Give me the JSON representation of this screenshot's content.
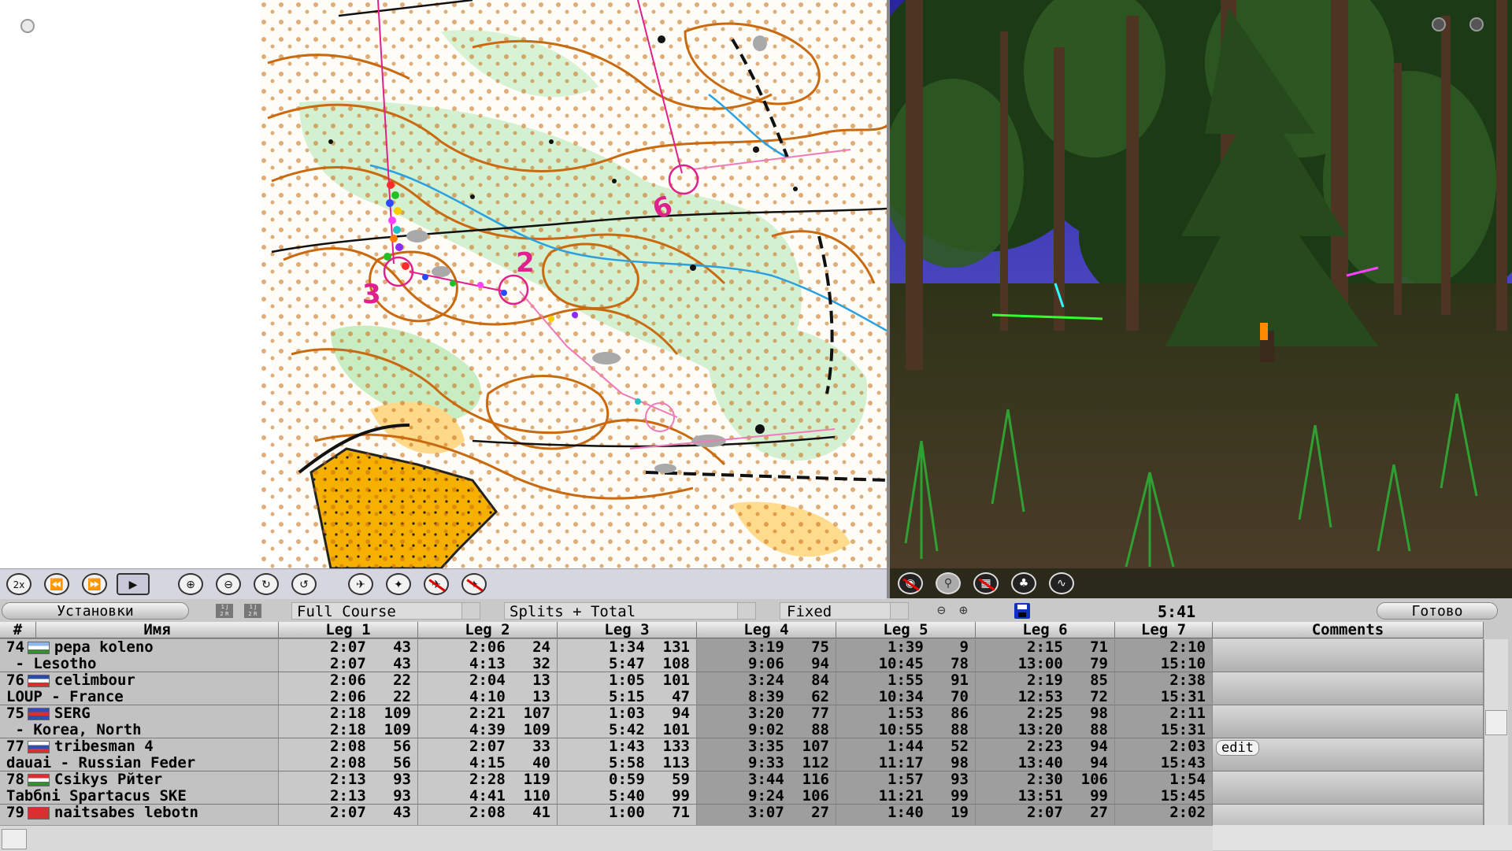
{
  "map_toolbar": {
    "speed_label": "2x",
    "icons": [
      "speed-icon",
      "rewind-icon",
      "fast-forward-icon",
      "play-icon",
      "zoom-in-icon",
      "zoom-out-icon",
      "rotate-right-icon",
      "rotate-left-icon",
      "runner-icon",
      "compass-icon",
      "route-off-icon",
      "tail-off-icon"
    ]
  },
  "view_toolbar": {
    "icons": [
      "camera-off-icon",
      "search-icon",
      "map-off-icon",
      "tree-icon",
      "route-icon"
    ]
  },
  "control_bar": {
    "settings_label": "Установки",
    "course_value": "Full Course",
    "splits_value": "Splits + Total",
    "mode_value": "Fixed",
    "time": "5:41",
    "done_label": "Готово",
    "mini_icon_1": "1 Job\n2 Rob\n3 Bot",
    "mini_icon_2": "1 Job\n2 Rob\n3 Bot"
  },
  "table": {
    "headers": [
      "#",
      "Имя",
      "Leg 1",
      "Leg 2",
      "Leg 3",
      "Leg 4",
      "Leg 5",
      "Leg 6",
      "Leg 7",
      "Comments"
    ],
    "rows": [
      {
        "line1": "74",
        "flag": [
          "#8fb8e8",
          "#ffffff",
          "#3a8a3a"
        ],
        "name1": "pepa koleno",
        "name2": " - Lesotho",
        "legs": [
          [
            "2:07   43",
            "2:07   43"
          ],
          [
            "2:06   24",
            "4:13   32"
          ],
          [
            "1:34  131",
            "5:47  108"
          ],
          [
            "3:19   75",
            "9:06   94"
          ],
          [
            "1:39    9",
            "10:45   78"
          ],
          [
            "2:15   71",
            "13:00   79"
          ],
          [
            "2:10",
            "15:10"
          ]
        ],
        "comment": ""
      },
      {
        "line1": "76",
        "flag": [
          "#2a4aa8",
          "#ffffff",
          "#d83030"
        ],
        "name1": "celimbour",
        "name2": "LOUP - France",
        "legs": [
          [
            "2:06   22",
            "2:06   22"
          ],
          [
            "2:04   13",
            "4:10   13"
          ],
          [
            "1:05  101",
            "5:15   47"
          ],
          [
            "3:24   84",
            "8:39   62"
          ],
          [
            "1:55   91",
            "10:34   70"
          ],
          [
            "2:19   85",
            "12:53   72"
          ],
          [
            "2:38",
            "15:31"
          ]
        ],
        "comment": ""
      },
      {
        "line1": "75",
        "flag": [
          "#3050b0",
          "#d83030",
          "#3050b0"
        ],
        "name1": "SERG",
        "name2": " - Korea, North",
        "legs": [
          [
            "2:18  109",
            "2:18  109"
          ],
          [
            "2:21  107",
            "4:39  109"
          ],
          [
            "1:03   94",
            "5:42  101"
          ],
          [
            "3:20   77",
            "9:02   88"
          ],
          [
            "1:53   86",
            "10:55   88"
          ],
          [
            "2:25   98",
            "13:20   88"
          ],
          [
            "2:11",
            "15:31"
          ]
        ],
        "comment": ""
      },
      {
        "line1": "77",
        "flag": [
          "#ffffff",
          "#3050b0",
          "#d83030"
        ],
        "name1": "tribesman 4",
        "name2": "dauai - Russian Feder",
        "legs": [
          [
            "2:08   56",
            "2:08   56"
          ],
          [
            "2:07   33",
            "4:15   40"
          ],
          [
            "1:43  133",
            "5:58  113"
          ],
          [
            "3:35  107",
            "9:33  112"
          ],
          [
            "1:44   52",
            "11:17   98"
          ],
          [
            "2:23   94",
            "13:40   94"
          ],
          [
            "2:03",
            "15:43"
          ]
        ],
        "comment": "edit"
      },
      {
        "line1": "78",
        "flag": [
          "#d83030",
          "#ffffff",
          "#3a8a3a"
        ],
        "name1": "Csikys Pйter",
        "name2": "Tabбni Spartacus SKE",
        "legs": [
          [
            "2:13   93",
            "2:13   93"
          ],
          [
            "2:28  119",
            "4:41  110"
          ],
          [
            "0:59   59",
            "5:40   99"
          ],
          [
            "3:44  116",
            "9:24  106"
          ],
          [
            "1:57   93",
            "11:21   99"
          ],
          [
            "2:30  106",
            "13:51   99"
          ],
          [
            "1:54",
            "15:45"
          ]
        ],
        "comment": ""
      },
      {
        "line1": "79",
        "flag": [
          "#d83030",
          "#d83030",
          "#d83030"
        ],
        "name1": "naitsabes lebotn",
        "name2": "",
        "legs": [
          [
            "2:07   43",
            ""
          ],
          [
            "2:08   41",
            ""
          ],
          [
            "1:00   71",
            ""
          ],
          [
            "3:07   27",
            ""
          ],
          [
            "1:40   19",
            ""
          ],
          [
            "2:07   27",
            ""
          ],
          [
            "2:02",
            ""
          ]
        ],
        "comment": ""
      }
    ]
  },
  "map_labels": {
    "control_3": "3",
    "control_2": "2",
    "control_6": "6"
  }
}
